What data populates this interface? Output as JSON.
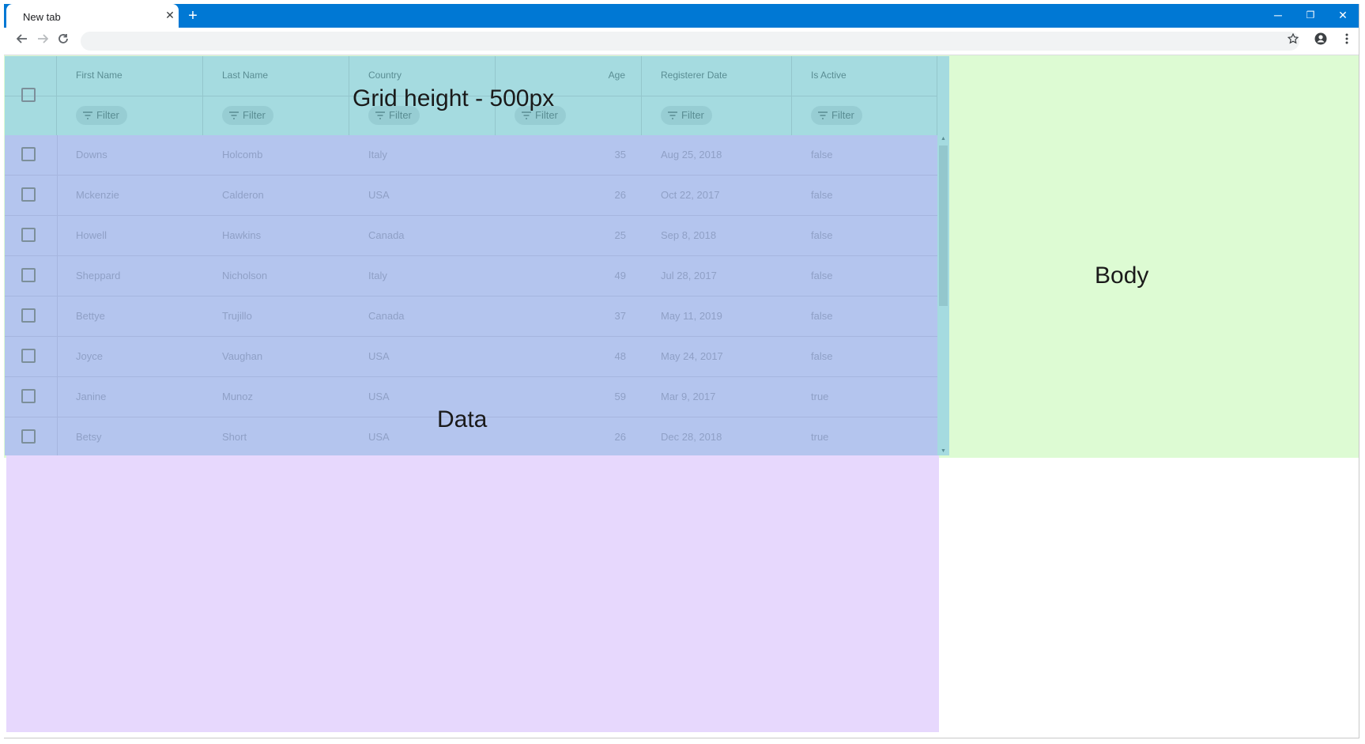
{
  "browser": {
    "tab_title": "New tab",
    "tab_close": "✕",
    "new_tab": "+",
    "window_minimize": "─",
    "window_restore": "❐",
    "window_close": "✕",
    "address_value": "",
    "colors": {
      "titlebar": "#0078d4"
    }
  },
  "overlays": {
    "body_label": "Body",
    "grid_label": "Grid height - 500px",
    "data_label": "Data",
    "colors": {
      "body": "#ddfbd3",
      "grid": "#a5dbe0",
      "data": "#e7d8fd",
      "rows": "#b4c5ee"
    }
  },
  "grid": {
    "filter_label": "Filter",
    "columns": [
      "First Name",
      "Last Name",
      "Country",
      "Age",
      "Registerer Date",
      "Is Active"
    ],
    "rows": [
      [
        "Downs",
        "Holcomb",
        "Italy",
        "35",
        "Aug 25, 2018",
        "false"
      ],
      [
        "Mckenzie",
        "Calderon",
        "USA",
        "26",
        "Oct 22, 2017",
        "false"
      ],
      [
        "Howell",
        "Hawkins",
        "Canada",
        "25",
        "Sep 8, 2018",
        "false"
      ],
      [
        "Sheppard",
        "Nicholson",
        "Italy",
        "49",
        "Jul 28, 2017",
        "false"
      ],
      [
        "Bettye",
        "Trujillo",
        "Canada",
        "37",
        "May 11, 2019",
        "false"
      ],
      [
        "Joyce",
        "Vaughan",
        "USA",
        "48",
        "May 24, 2017",
        "false"
      ],
      [
        "Janine",
        "Munoz",
        "USA",
        "59",
        "Mar 9, 2017",
        "true"
      ],
      [
        "Betsy",
        "Short",
        "USA",
        "26",
        "Dec 28, 2018",
        "true"
      ]
    ]
  }
}
